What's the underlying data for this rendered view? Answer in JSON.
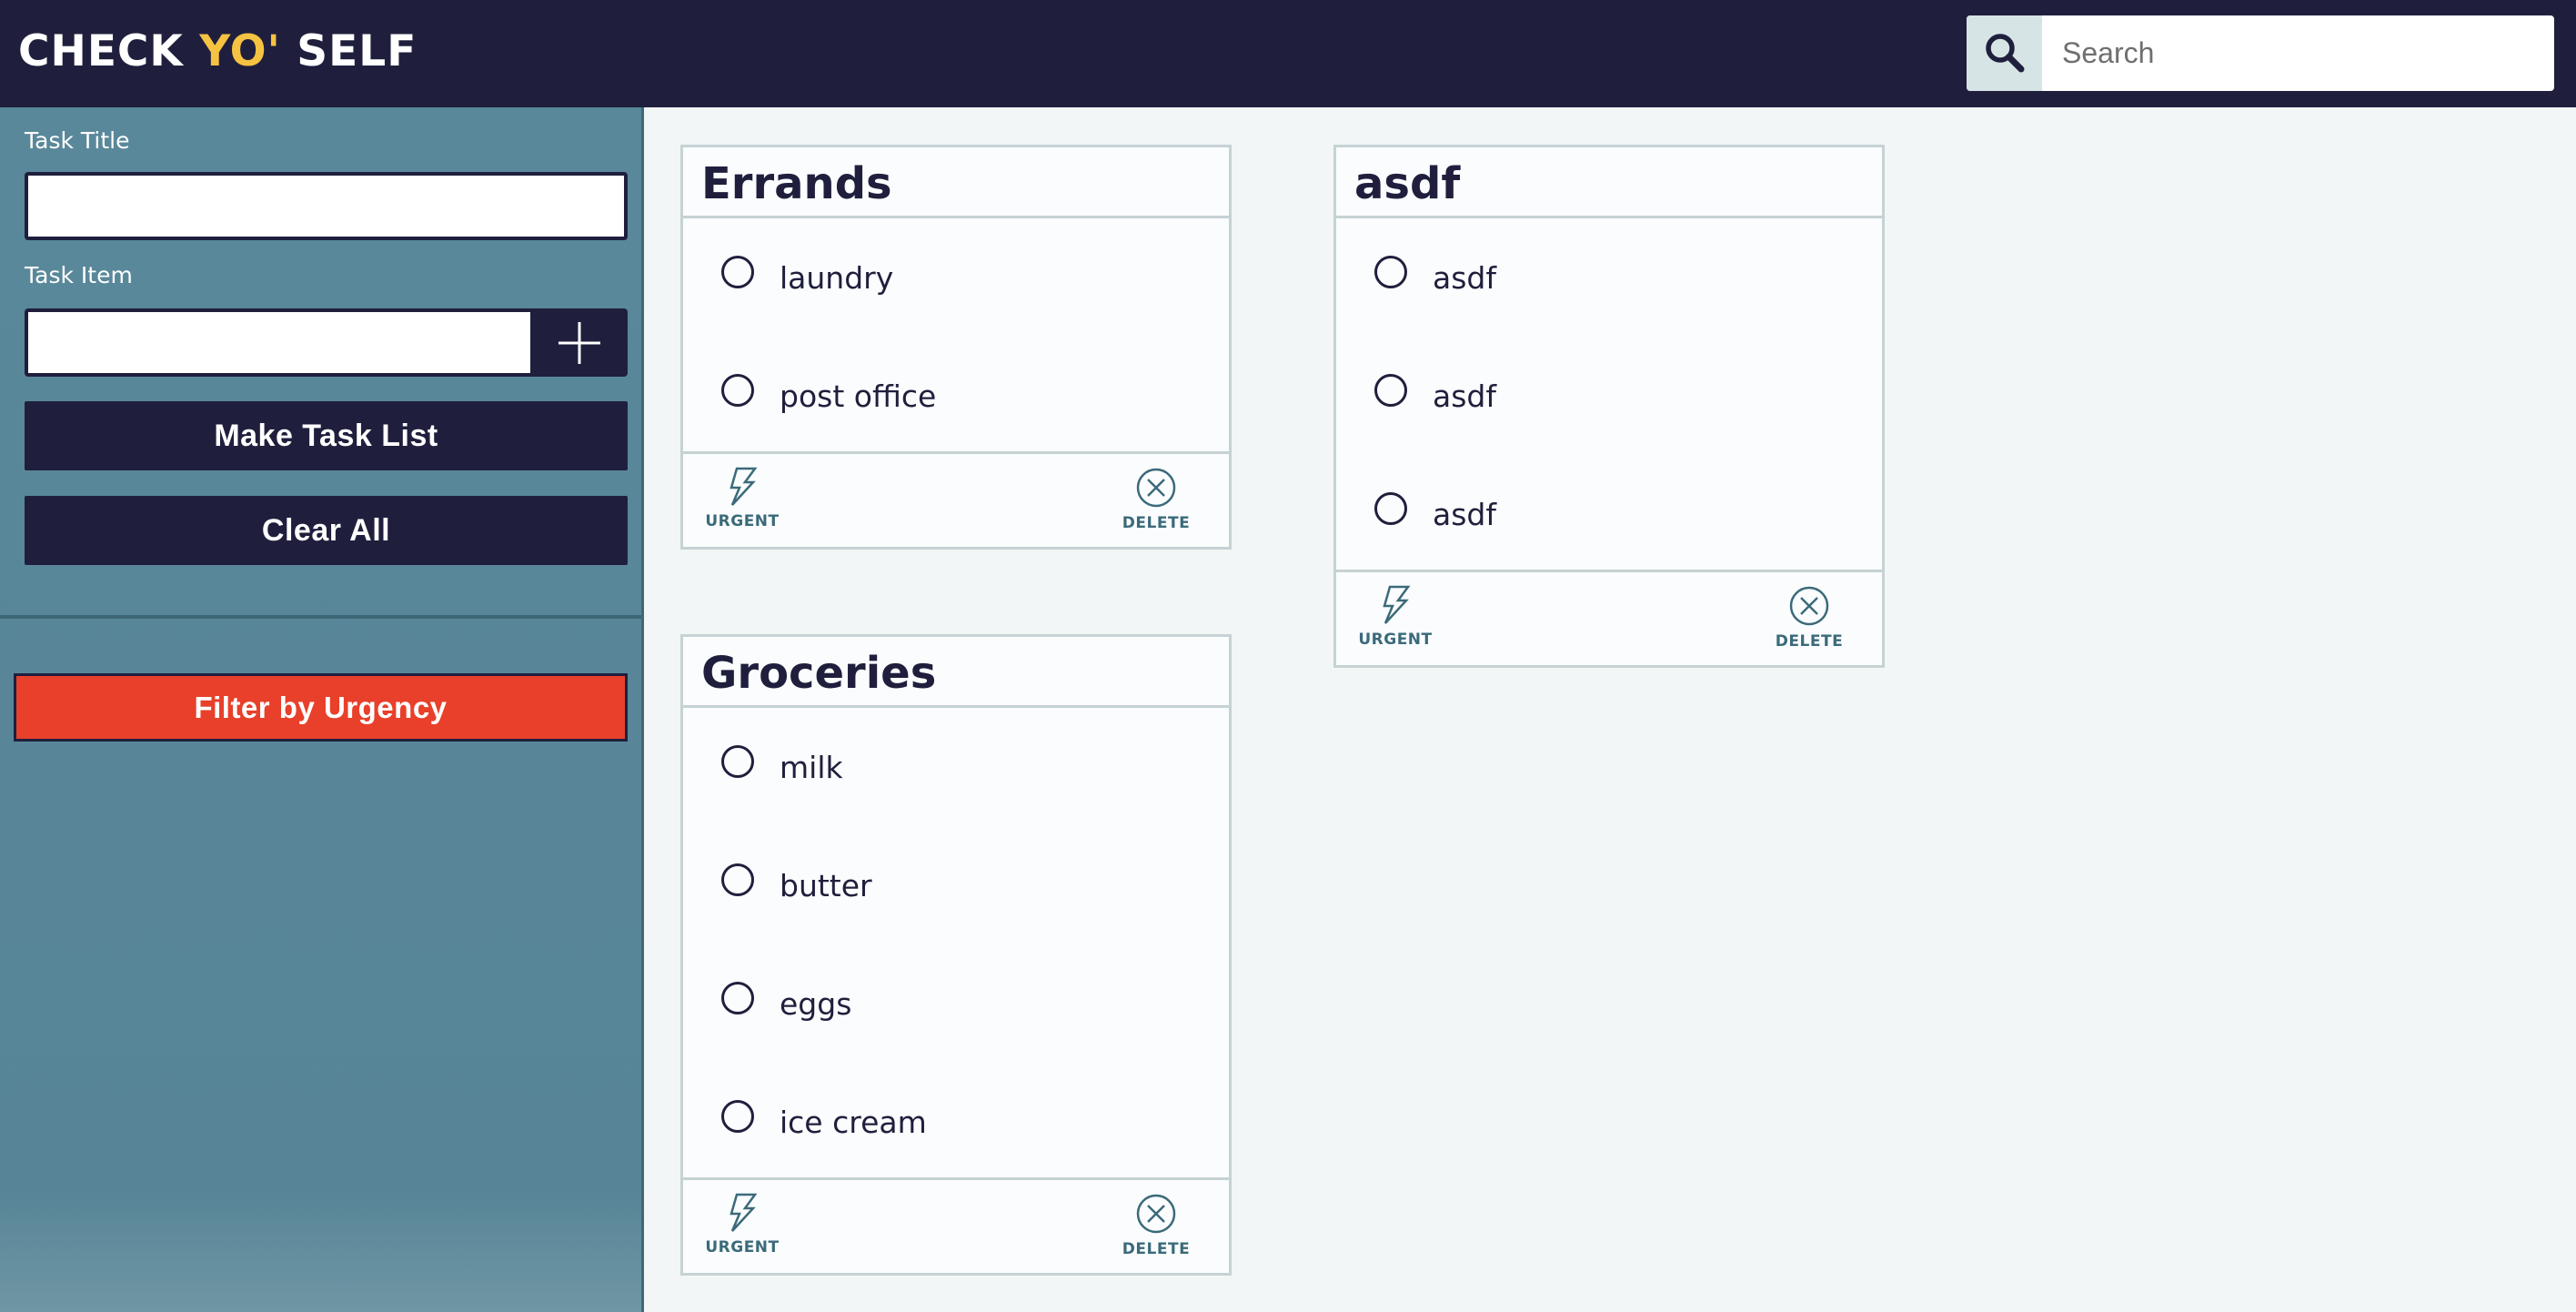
{
  "app": {
    "title_part1": "CHECK ",
    "title_accent": "YO'",
    "title_part2": " SELF"
  },
  "search": {
    "icon": "search-icon",
    "placeholder": "Search",
    "value": ""
  },
  "sidebar": {
    "task_title_label": "Task Title",
    "task_title_value": "",
    "task_item_label": "Task Item",
    "task_item_value": "",
    "add_icon": "plus-icon",
    "make_task_list_label": "Make Task List",
    "clear_all_label": "Clear All",
    "filter_label": "Filter by Urgency"
  },
  "colors": {
    "header": "#1f1f3d",
    "accent": "#f5c242",
    "sidebar": "#59889a",
    "filter_button": "#e8402a",
    "card_border": "#c6d2d4",
    "footer_text": "#3b6a7a"
  },
  "cards": [
    {
      "title": "Errands",
      "items": [
        "laundry",
        "post office"
      ],
      "urgent_label": "URGENT",
      "delete_label": "DELETE"
    },
    {
      "title": "Groceries",
      "items": [
        "milk",
        "butter",
        "eggs",
        "ice cream"
      ],
      "urgent_label": "URGENT",
      "delete_label": "DELETE"
    },
    {
      "title": "asdf",
      "items": [
        "asdf",
        "asdf",
        "asdf"
      ],
      "urgent_label": "URGENT",
      "delete_label": "DELETE"
    }
  ]
}
